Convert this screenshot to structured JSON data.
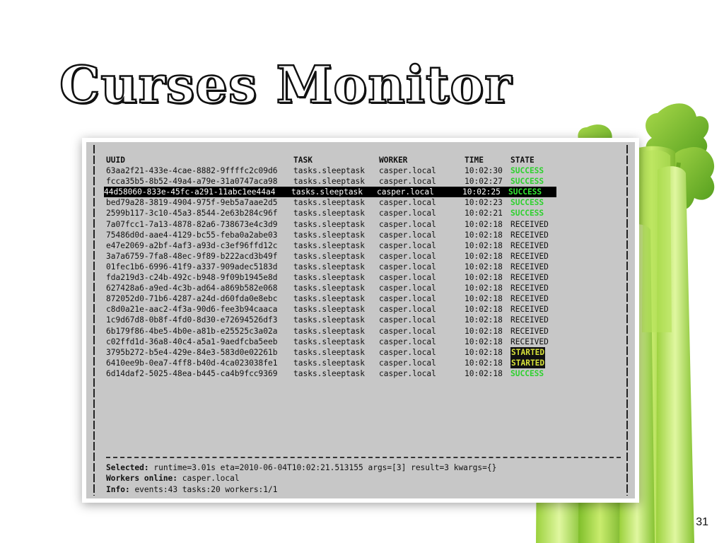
{
  "slide": {
    "title": "Curses Monitor",
    "page_number": "31"
  },
  "monitor": {
    "columns": {
      "uuid": "UUID",
      "task": "TASK",
      "worker": "WORKER",
      "time": "TIME",
      "state": "STATE"
    },
    "rows": [
      {
        "uuid": "63aa2f21-433e-4cae-8882-9ffffc2c09d6",
        "task": "tasks.sleeptask",
        "worker": "casper.local",
        "time": "10:02:30",
        "state": "SUCCESS"
      },
      {
        "uuid": "fcca35b5-8b52-49a4-a79e-31a0747aca98",
        "task": "tasks.sleeptask",
        "worker": "casper.local",
        "time": "10:02:27",
        "state": "SUCCESS"
      },
      {
        "uuid": "44d58060-833e-45fc-a291-11abc1ee44a4",
        "task": "tasks.sleeptask",
        "worker": "casper.local",
        "time": "10:02:25",
        "state": "SUCCESS",
        "selected": true
      },
      {
        "uuid": "bed79a28-3819-4904-975f-9eb5a7aae2d5",
        "task": "tasks.sleeptask",
        "worker": "casper.local",
        "time": "10:02:23",
        "state": "SUCCESS"
      },
      {
        "uuid": "2599b117-3c10-45a3-8544-2e63b284c96f",
        "task": "tasks.sleeptask",
        "worker": "casper.local",
        "time": "10:02:21",
        "state": "SUCCESS"
      },
      {
        "uuid": "7a07fcc1-7a13-4878-82a6-738673e4c3d9",
        "task": "tasks.sleeptask",
        "worker": "casper.local",
        "time": "10:02:18",
        "state": "RECEIVED"
      },
      {
        "uuid": "75486d0d-aae4-4129-bc55-feba0a2abe03",
        "task": "tasks.sleeptask",
        "worker": "casper.local",
        "time": "10:02:18",
        "state": "RECEIVED"
      },
      {
        "uuid": "e47e2069-a2bf-4af3-a93d-c3ef96ffd12c",
        "task": "tasks.sleeptask",
        "worker": "casper.local",
        "time": "10:02:18",
        "state": "RECEIVED"
      },
      {
        "uuid": "3a7a6759-7fa8-48ec-9f89-b222acd3b49f",
        "task": "tasks.sleeptask",
        "worker": "casper.local",
        "time": "10:02:18",
        "state": "RECEIVED"
      },
      {
        "uuid": "01fec1b6-6996-41f9-a337-909adec5183d",
        "task": "tasks.sleeptask",
        "worker": "casper.local",
        "time": "10:02:18",
        "state": "RECEIVED"
      },
      {
        "uuid": "fda219d3-c24b-492c-b948-9f09b1945e8d",
        "task": "tasks.sleeptask",
        "worker": "casper.local",
        "time": "10:02:18",
        "state": "RECEIVED"
      },
      {
        "uuid": "627428a6-a9ed-4c3b-ad64-a869b582e068",
        "task": "tasks.sleeptask",
        "worker": "casper.local",
        "time": "10:02:18",
        "state": "RECEIVED"
      },
      {
        "uuid": "872052d0-71b6-4287-a24d-d60fda0e8ebc",
        "task": "tasks.sleeptask",
        "worker": "casper.local",
        "time": "10:02:18",
        "state": "RECEIVED"
      },
      {
        "uuid": "c8d0a21e-aac2-4f3a-90d6-fee3b94caaca",
        "task": "tasks.sleeptask",
        "worker": "casper.local",
        "time": "10:02:18",
        "state": "RECEIVED"
      },
      {
        "uuid": "1c9d67d8-0b8f-4fd0-8d30-e72694526df3",
        "task": "tasks.sleeptask",
        "worker": "casper.local",
        "time": "10:02:18",
        "state": "RECEIVED"
      },
      {
        "uuid": "6b179f86-4be5-4b0e-a81b-e25525c3a02a",
        "task": "tasks.sleeptask",
        "worker": "casper.local",
        "time": "10:02:18",
        "state": "RECEIVED"
      },
      {
        "uuid": "c02ffd1d-36a8-40c4-a5a1-9aedfcba5eeb",
        "task": "tasks.sleeptask",
        "worker": "casper.local",
        "time": "10:02:18",
        "state": "RECEIVED"
      },
      {
        "uuid": "3795b272-b5e4-429e-84e3-583d0e02261b",
        "task": "tasks.sleeptask",
        "worker": "casper.local",
        "time": "10:02:18",
        "state": "STARTED"
      },
      {
        "uuid": "6410ee9b-0ea7-4ff8-b40d-4ca023038fe1",
        "task": "tasks.sleeptask",
        "worker": "casper.local",
        "time": "10:02:18",
        "state": "STARTED"
      },
      {
        "uuid": "6d14daf2-5025-48ea-b445-ca4b9fcc9369",
        "task": "tasks.sleeptask",
        "worker": "casper.local",
        "time": "10:02:18",
        "state": "SUCCESS"
      }
    ],
    "footer": {
      "selected_label": "Selected:",
      "selected_value": "runtime=3.01s eta=2010-06-04T10:02:21.513155 args=[3] result=3 kwargs={}",
      "workers_label": "Workers online:",
      "workers_value": "casper.local",
      "info_label": "Info:",
      "info_value": "events:43 tasks:20 workers:1/1"
    }
  },
  "colors": {
    "success": "#2fd12f",
    "started_text": "#d8e23a",
    "terminal_bg": "#c7c7c7",
    "celery_green": "#8cc63f"
  },
  "icons": {
    "decoration": "celery-stalk-illustration"
  }
}
